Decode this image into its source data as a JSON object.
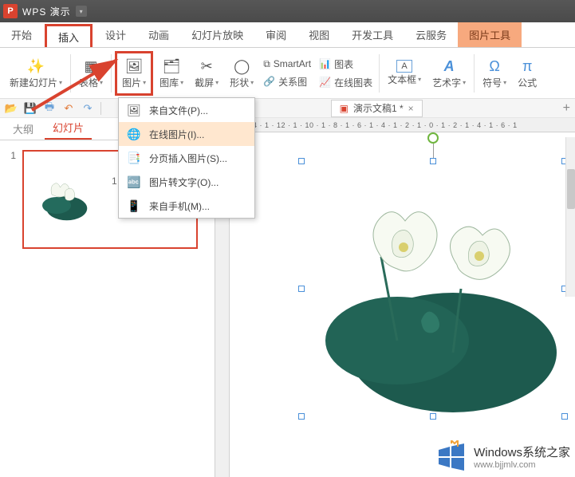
{
  "title": "WPS 演示",
  "tabs": {
    "start": "开始",
    "insert": "插入",
    "design": "设计",
    "animation": "动画",
    "slideshow": "幻灯片放映",
    "review": "审阅",
    "view": "视图",
    "devtools": "开发工具",
    "cloud": "云服务",
    "pictools": "图片工具"
  },
  "ribbon": {
    "new_slide": "新建幻灯片",
    "table": "表格",
    "picture": "图片",
    "gallery": "图库",
    "screenshot": "截屏",
    "shape": "形状",
    "smartart": "SmartArt",
    "chart": "图表",
    "relation": "关系图",
    "online_chart": "在线图表",
    "textbox": "文本框",
    "wordart": "艺术字",
    "symbol": "符号",
    "formula": "公式"
  },
  "dropdown": {
    "from_file": "来自文件(P)...",
    "online_picture": "在线图片(I)...",
    "paginated": "分页插入图片(S)...",
    "to_text": "图片转文字(O)...",
    "from_phone": "来自手机(M)..."
  },
  "doc": {
    "name": "演示文稿1 *"
  },
  "side": {
    "outline": "大纲",
    "slides": "幻灯片",
    "num1": "1",
    "num_hidden": "1"
  },
  "ruler": "· 1 · 14 · 1 · 12 · 1 · 10 · 1 · 8 · 1 · 6 · 1 · 4 · 1 · 2 · 1 · 0 · 1 · 2 · 1 · 4 · 1 · 6 · 1",
  "watermark": {
    "brand": "Windows",
    "brand2": "系统之家",
    "url": "www.bjjmlv.com"
  },
  "colors": {
    "accent": "#d9432f",
    "lotus_leaf": "#1d5a4e",
    "lotus_flower": "#f5f8f0"
  }
}
